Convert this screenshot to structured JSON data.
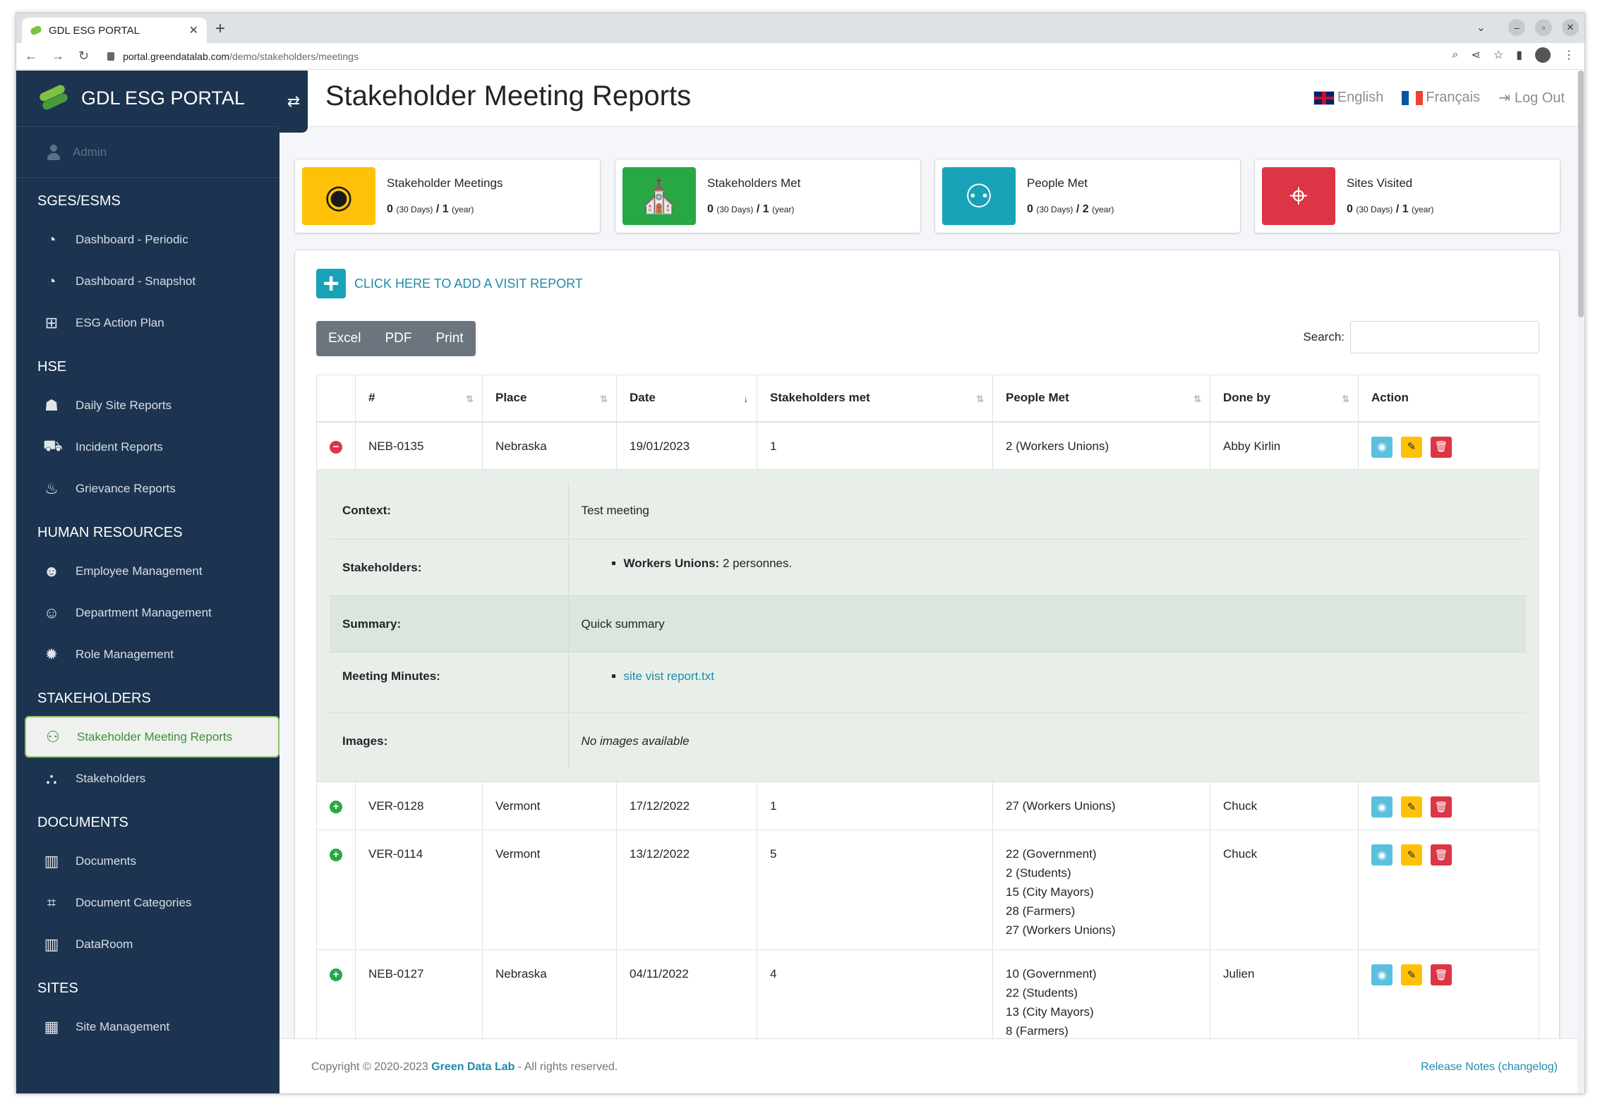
{
  "browser": {
    "tab_title": "GDL ESG PORTAL",
    "url_host": "portal.greendatalab.com",
    "url_path": "/demo/stakeholders/meetings"
  },
  "sidebar": {
    "brand": "GDL ESG PORTAL",
    "user": "Admin",
    "sections": [
      {
        "title": "SGES/ESMS",
        "items": [
          {
            "label": "Dashboard - Periodic",
            "icon": "pie-chart-icon"
          },
          {
            "label": "Dashboard - Snapshot",
            "icon": "pie-chart-icon"
          },
          {
            "label": "ESG Action Plan",
            "icon": "sitemap-icon"
          }
        ]
      },
      {
        "title": "HSE",
        "items": [
          {
            "label": "Daily Site Reports",
            "icon": "hard-hat-worker-icon"
          },
          {
            "label": "Incident Reports",
            "icon": "car-crash-icon"
          },
          {
            "label": "Grievance Reports",
            "icon": "megaphone-icon"
          }
        ]
      },
      {
        "title": "HUMAN RESOURCES",
        "items": [
          {
            "label": "Employee Management",
            "icon": "users-icon"
          },
          {
            "label": "Department Management",
            "icon": "user-friends-icon"
          },
          {
            "label": "Role Management",
            "icon": "cog-icon"
          }
        ]
      },
      {
        "title": "STAKEHOLDERS",
        "items": [
          {
            "label": "Stakeholder Meeting Reports",
            "icon": "handshake-icon"
          },
          {
            "label": "Stakeholders",
            "icon": "network-icon"
          }
        ]
      },
      {
        "title": "DOCUMENTS",
        "items": [
          {
            "label": "Documents",
            "icon": "book-icon"
          },
          {
            "label": "Document Categories",
            "icon": "crop-icon"
          },
          {
            "label": "DataRoom",
            "icon": "book-icon"
          }
        ]
      },
      {
        "title": "SITES",
        "items": [
          {
            "label": "Site Management",
            "icon": "city-icon"
          }
        ]
      }
    ]
  },
  "header": {
    "title": "Stakeholder Meeting Reports",
    "lang_en": "English",
    "lang_fr": "Français",
    "logout": "Log Out"
  },
  "infoboxes": [
    {
      "label": "Stakeholder Meetings",
      "d30": "0",
      "d30_unit": "(30 Days)",
      "year": "1",
      "year_unit": "(year)",
      "color": "#ffc107",
      "icon": "eye-icon"
    },
    {
      "label": "Stakeholders Met",
      "d30": "0",
      "d30_unit": "(30 Days)",
      "year": "1",
      "year_unit": "(year)",
      "color": "#28a745",
      "icon": "church-icon"
    },
    {
      "label": "People Met",
      "d30": "0",
      "d30_unit": "(30 Days)",
      "year": "2",
      "year_unit": "(year)",
      "color": "#17a2b8",
      "icon": "handshake-icon"
    },
    {
      "label": "Sites Visited",
      "d30": "0",
      "d30_unit": "(30 Days)",
      "year": "1",
      "year_unit": "(year)",
      "color": "#dc3545",
      "icon": "map-marker-icon"
    }
  ],
  "actions": {
    "add_report": "CLICK HERE TO ADD A VISIT REPORT",
    "excel": "Excel",
    "pdf": "PDF",
    "print": "Print",
    "search_label": "Search:"
  },
  "table": {
    "headers": [
      "#",
      "Place",
      "Date",
      "Stakeholders met",
      "People Met",
      "Done by",
      "Action"
    ],
    "rows": [
      {
        "id": "NEB-0135",
        "place": "Nebraska",
        "date": "19/01/2023",
        "stakeholders": "1",
        "people": [
          "2 (Workers Unions)"
        ],
        "done_by": "Abby Kirlin",
        "expanded": true
      },
      {
        "id": "VER-0128",
        "place": "Vermont",
        "date": "17/12/2022",
        "stakeholders": "1",
        "people": [
          "27 (Workers Unions)"
        ],
        "done_by": "Chuck",
        "expanded": false
      },
      {
        "id": "VER-0114",
        "place": "Vermont",
        "date": "13/12/2022",
        "stakeholders": "5",
        "people": [
          "22 (Government)",
          "2 (Students)",
          "15 (City Mayors)",
          "28 (Farmers)",
          "27 (Workers Unions)"
        ],
        "done_by": "Chuck",
        "expanded": false
      },
      {
        "id": "NEB-0127",
        "place": "Nebraska",
        "date": "04/11/2022",
        "stakeholders": "4",
        "people": [
          "10 (Government)",
          "22 (Students)",
          "13 (City Mayors)",
          "8 (Farmers)"
        ],
        "done_by": "Julien",
        "expanded": false
      }
    ],
    "detail": {
      "context_label": "Context:",
      "context": "Test meeting",
      "stakeholders_label": "Stakeholders:",
      "stakeholder_bold": "Workers Unions:",
      "stakeholder_rest": " 2 personnes.",
      "summary_label": "Summary:",
      "summary": "Quick summary",
      "minutes_label": "Meeting Minutes:",
      "minutes_file": "site vist report.txt",
      "images_label": "Images:",
      "images": "No images available"
    }
  },
  "footer": {
    "copyright": "Copyright © 2020-2023",
    "company": "Green Data Lab",
    "rights": "- All rights reserved.",
    "release_notes": "Release Notes (changelog)"
  }
}
